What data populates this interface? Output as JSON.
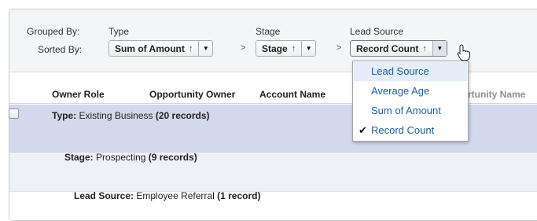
{
  "controls": {
    "grouped_by_label": "Grouped By:",
    "sorted_by_label": "Sorted By:",
    "groups": [
      {
        "title": "Type",
        "value": "Sum of Amount",
        "sort": "↑"
      },
      {
        "title": "Stage",
        "value": "Stage",
        "sort": "↑"
      },
      {
        "title": "Lead Source",
        "value": "Record Count",
        "sort": "↑"
      }
    ],
    "chevron": ">"
  },
  "columns": [
    "Owner Role",
    "Opportunity Owner",
    "Account Name",
    "Opportunity Name"
  ],
  "columns_visible_suffix": "rtunity Name",
  "groups_rows": {
    "type_label": "Type:",
    "type_value": "Existing Business",
    "type_count": "(20 records)",
    "stage_label": "Stage:",
    "stage_value": "Prospecting",
    "stage_count": "(9 records)",
    "lead_label": "Lead Source:",
    "lead_value": "Employee Referral",
    "lead_count": "(1 record)"
  },
  "menu": {
    "items": [
      {
        "label": "Lead Source",
        "checked": false,
        "highlighted": true
      },
      {
        "label": "Average Age",
        "checked": false,
        "highlighted": false
      },
      {
        "label": "Sum of Amount",
        "checked": false,
        "highlighted": false
      },
      {
        "label": "Record Count",
        "checked": true,
        "highlighted": false
      }
    ],
    "check_glyph": "✔"
  },
  "colors": {
    "type_row_bg": "#d3d8ec",
    "stage_row_bg": "#eef1f6",
    "menu_link": "#1d5ea7"
  }
}
